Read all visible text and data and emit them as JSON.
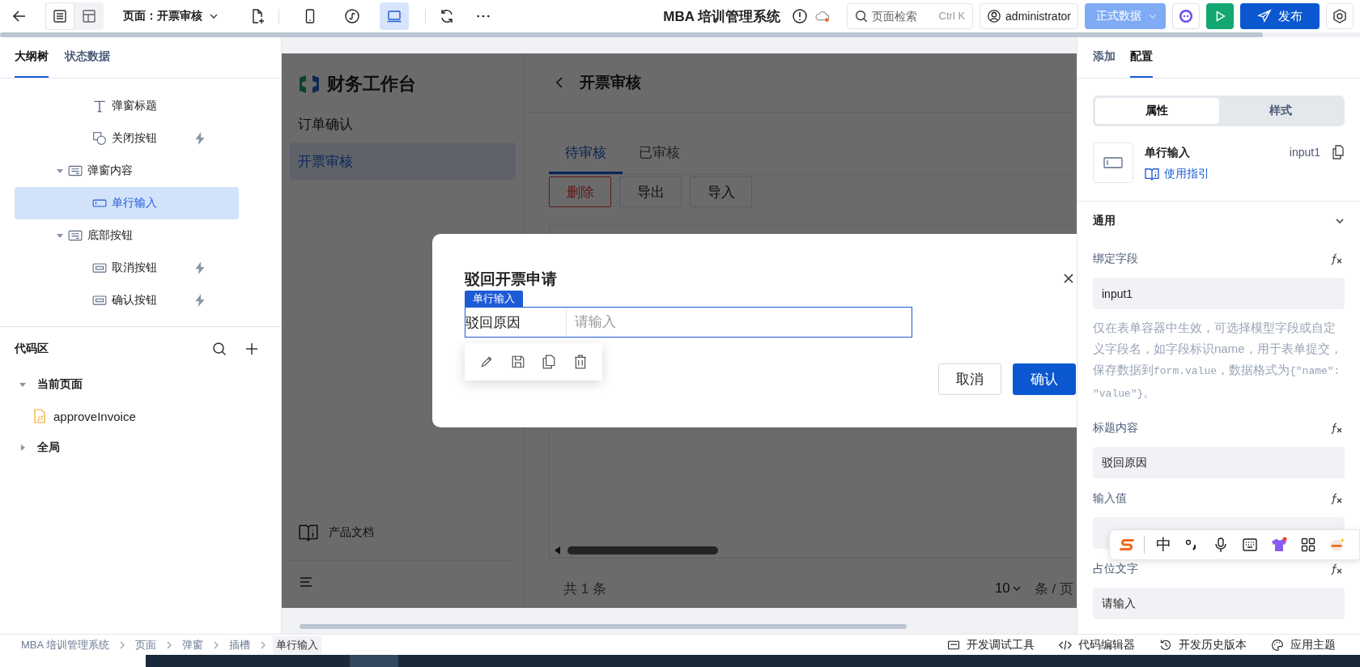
{
  "toolbar": {
    "view_toggles": [
      {
        "kind": "outline",
        "selected": true
      },
      {
        "kind": "layout",
        "selected": false
      }
    ],
    "page_selector": "页面：开票审核",
    "devices": [
      {
        "kind": "mobile",
        "selected": false
      },
      {
        "kind": "miniprogram",
        "selected": false
      },
      {
        "kind": "desktop",
        "selected": true
      }
    ],
    "app_title": "MBA 培训管理系统",
    "search": {
      "placeholder": "页面检索",
      "shortcut": "Ctrl K"
    },
    "user": "administrator",
    "data_env": "正式数据",
    "publish": "发布"
  },
  "left_panel": {
    "tabs": [
      {
        "label": "大纲树",
        "selected": true
      },
      {
        "label": "状态数据",
        "selected": false
      }
    ],
    "tree": [
      {
        "children": [
          {
            "label": "弹窗标题",
            "kind": "text",
            "has_event": false,
            "selected": false
          },
          {
            "label": "关闭按钮",
            "kind": "shape",
            "has_event": true,
            "selected": false
          }
        ]
      },
      {
        "label": "弹窗内容",
        "kind": "container",
        "expanded": true,
        "has_event": false,
        "selected": false,
        "children": [
          {
            "label": "单行输入",
            "kind": "input",
            "has_event": false,
            "selected": true
          }
        ]
      },
      {
        "label": "底部按钮",
        "kind": "container",
        "expanded": true,
        "has_event": false,
        "selected": false,
        "children": [
          {
            "label": "取消按钮",
            "kind": "button",
            "has_event": true,
            "selected": false
          },
          {
            "label": "确认按钮",
            "kind": "button",
            "has_event": true,
            "selected": false
          }
        ]
      }
    ],
    "code_area": {
      "title": "代码区",
      "groups": [
        {
          "label": "当前页面",
          "expanded": true,
          "files": [
            "approveInvoice"
          ]
        },
        {
          "label": "全局",
          "expanded": false
        }
      ]
    }
  },
  "canvas": {
    "app": {
      "brand": "财务工作台",
      "menu": [
        {
          "label": "订单确认",
          "selected": false
        },
        {
          "label": "开票审核",
          "selected": true
        }
      ],
      "docs": "产品文档",
      "page_title": "开票审核",
      "tabs": [
        {
          "label": "待审核",
          "selected": true
        },
        {
          "label": "已审核",
          "selected": false
        }
      ],
      "actions": [
        {
          "label": "删除",
          "kind": "danger"
        },
        {
          "label": "导出",
          "kind": "default"
        },
        {
          "label": "导入",
          "kind": "default"
        }
      ],
      "pagination": {
        "total": "共 1 条",
        "page_size": "10",
        "per_page": "条 / 页"
      }
    },
    "dialog": {
      "title": "驳回开票申请",
      "component_tag": "单行输入",
      "field_label": "驳回原因",
      "placeholder": "请输入",
      "buttons": [
        {
          "label": "取消",
          "kind": "default"
        },
        {
          "label": "确认",
          "kind": "primary"
        }
      ]
    }
  },
  "right_panel": {
    "tabs": [
      {
        "label": "添加",
        "selected": false
      },
      {
        "label": "配置",
        "selected": true
      }
    ],
    "mode_tabs": [
      {
        "label": "属性",
        "selected": true
      },
      {
        "label": "样式",
        "selected": false
      }
    ],
    "component": {
      "name": "单行输入",
      "guide": "使用指引",
      "id": "input1"
    },
    "section": {
      "title": "通用",
      "expanded": true
    },
    "props": [
      {
        "label": "绑定字段",
        "value": "input1",
        "help": [
          {
            "kind": "plain",
            "text": "仅在表单容器中生效，可选择模型字段或自定义字段名，如字段标识name，用于表单提交，保存数据到"
          },
          {
            "kind": "code",
            "text": "form.value"
          },
          {
            "kind": "plain",
            "text": "，数据格式为"
          },
          {
            "kind": "code",
            "text": "{\"name\": \"value\"}"
          },
          {
            "kind": "plain",
            "text": "。"
          }
        ]
      },
      {
        "label": "标题内容",
        "value": "驳回原因"
      },
      {
        "label": "输入值"
      },
      {
        "label": "占位文字",
        "value": "请输入"
      }
    ]
  },
  "ime_toolbar": {
    "mode": "中"
  },
  "breadcrumb": [
    {
      "label": "MBA 培训管理系统",
      "selected": false
    },
    {
      "label": "页面",
      "selected": false
    },
    {
      "label": "弹窗",
      "selected": false
    },
    {
      "label": "插槽",
      "selected": false
    },
    {
      "label": "单行输入",
      "selected": true
    }
  ],
  "status_tools": [
    {
      "label": "开发调试工具",
      "kind": "debug"
    },
    {
      "label": "代码编辑器",
      "kind": "code"
    },
    {
      "label": "开发历史版本",
      "kind": "history"
    },
    {
      "label": "应用主题",
      "kind": "theme"
    }
  ]
}
